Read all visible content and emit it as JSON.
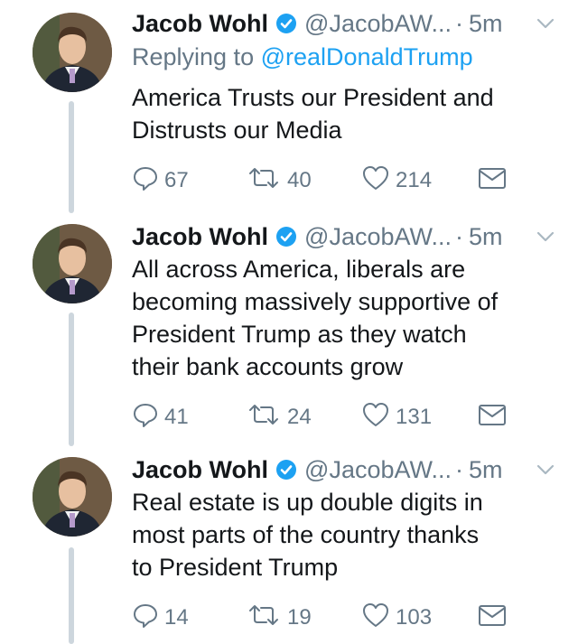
{
  "colors": {
    "link": "#1da1f2",
    "secondary_text": "#657786",
    "primary_text": "#14171a",
    "verified_badge": "#1da1f2",
    "thread_line": "#cdd6dd"
  },
  "tweets": [
    {
      "author_name": "Jacob Wohl",
      "handle": "@JacobAW...",
      "separator": "·",
      "time": "5m",
      "replying_to_label": "Replying to",
      "replying_to_mention": "@realDonaldTrump",
      "text_lines": [
        "America Trusts our President and",
        "Distrusts our Media"
      ],
      "replies": "67",
      "retweets": "40",
      "likes": "214"
    },
    {
      "author_name": "Jacob Wohl",
      "handle": "@JacobAW...",
      "separator": "·",
      "time": "5m",
      "text_lines": [
        "All across America, liberals are",
        "becoming massively supportive of",
        "President Trump as they watch",
        "their bank accounts grow"
      ],
      "replies": "41",
      "retweets": "24",
      "likes": "131"
    },
    {
      "author_name": "Jacob Wohl",
      "handle": "@JacobAW...",
      "separator": "·",
      "time": "5m",
      "text_lines": [
        "Real estate is up double digits in",
        "most parts of the country thanks",
        "to President Trump"
      ],
      "replies": "14",
      "retweets": "19",
      "likes": "103"
    }
  ],
  "icons": {
    "verified": "verified-badge-icon",
    "chevron": "chevron-down-icon",
    "reply": "reply-icon",
    "retweet": "retweet-icon",
    "like": "heart-icon",
    "dm": "envelope-icon"
  }
}
